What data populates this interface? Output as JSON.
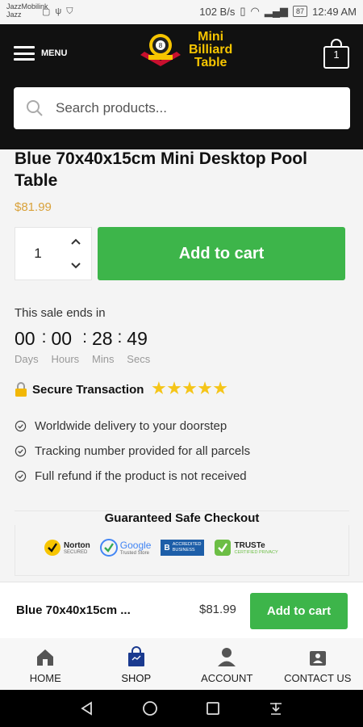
{
  "status_bar": {
    "carrier_line1": "JazzMobilink",
    "carrier_line2": "Jazz",
    "network_speed": "102 B/s",
    "battery": "87",
    "time": "12:49 AM"
  },
  "header": {
    "menu_label": "MENU",
    "logo_line1": "Mini",
    "logo_line2": "Billiard",
    "logo_line3": "Table",
    "cart_count": "1",
    "search_placeholder": "Search products..."
  },
  "product": {
    "title": "Blue 70x40x15cm Mini Desktop Pool Table",
    "price": "$81.99",
    "quantity": "1",
    "add_to_cart": "Add to cart"
  },
  "sale": {
    "label": "This sale ends in",
    "units": [
      {
        "value": "00",
        "label": "Days"
      },
      {
        "value": "00",
        "label": "Hours"
      },
      {
        "value": "28",
        "label": "Mins"
      },
      {
        "value": "49",
        "label": "Secs"
      }
    ]
  },
  "secure": {
    "label": "Secure Transaction",
    "rating": 5
  },
  "features": [
    "Worldwide delivery to your doorstep",
    "Tracking number provided for all parcels",
    "Full refund if the product is not received"
  ],
  "checkout": {
    "title": "Guaranteed Safe Checkout",
    "badges": {
      "norton": "Norton",
      "norton_sub": "SECURED",
      "google": "Google",
      "google_sub": "Trusted Store",
      "bbb_line1": "ACCREDITED",
      "bbb_line2": "BUSINESS",
      "truste": "TRUSTe",
      "truste_sub": "CERTIFIED PRIVACY"
    }
  },
  "sticky_bar": {
    "title": "Blue 70x40x15cm ...",
    "price": "$81.99",
    "button": "Add to cart"
  },
  "bottom_nav": [
    {
      "label": "HOME",
      "icon": "home-icon"
    },
    {
      "label": "SHOP",
      "icon": "shop-bag-icon"
    },
    {
      "label": "ACCOUNT",
      "icon": "account-icon"
    },
    {
      "label": "CONTACT US",
      "icon": "contact-icon"
    }
  ],
  "colors": {
    "header_bg": "#111111",
    "accent_green": "#3db54a",
    "price_gold": "#d9a23b",
    "logo_yellow": "#f7c500",
    "star_yellow": "#f5c518"
  }
}
